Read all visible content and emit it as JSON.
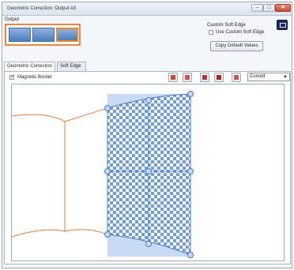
{
  "window": {
    "title": "Geometric Correction: Output A3",
    "minimize_icon": "minimize-icon",
    "maximize_icon": "maximize-icon",
    "close_icon": "close-icon"
  },
  "output": {
    "label": "Output",
    "selected_index": 2,
    "tiles": [
      "tile-1",
      "tile-2",
      "tile-3"
    ]
  },
  "soft_edge": {
    "heading": "Custom Soft Edge",
    "checkbox_label": "Use Custom Soft Edge",
    "checked": false,
    "button_label": "Copy Default Values"
  },
  "tabs": [
    {
      "label": "Geometric Correction",
      "active": true
    },
    {
      "label": "Soft Edge",
      "active": false
    }
  ],
  "toolbar": {
    "magnetic_label": "Magnetic Border",
    "magnetic_checked": true,
    "curve_mode": "Curved",
    "icons": [
      "align-top-left-icon",
      "align-top-right-icon",
      "align-bottom-left-icon",
      "align-bottom-right-icon",
      "reset-icon"
    ]
  },
  "colors": {
    "accent": "#e78544",
    "grid_handle": "#4a79c8",
    "checker_blue": "#6e9ddc",
    "screen_fill": "#c9dbf4"
  }
}
